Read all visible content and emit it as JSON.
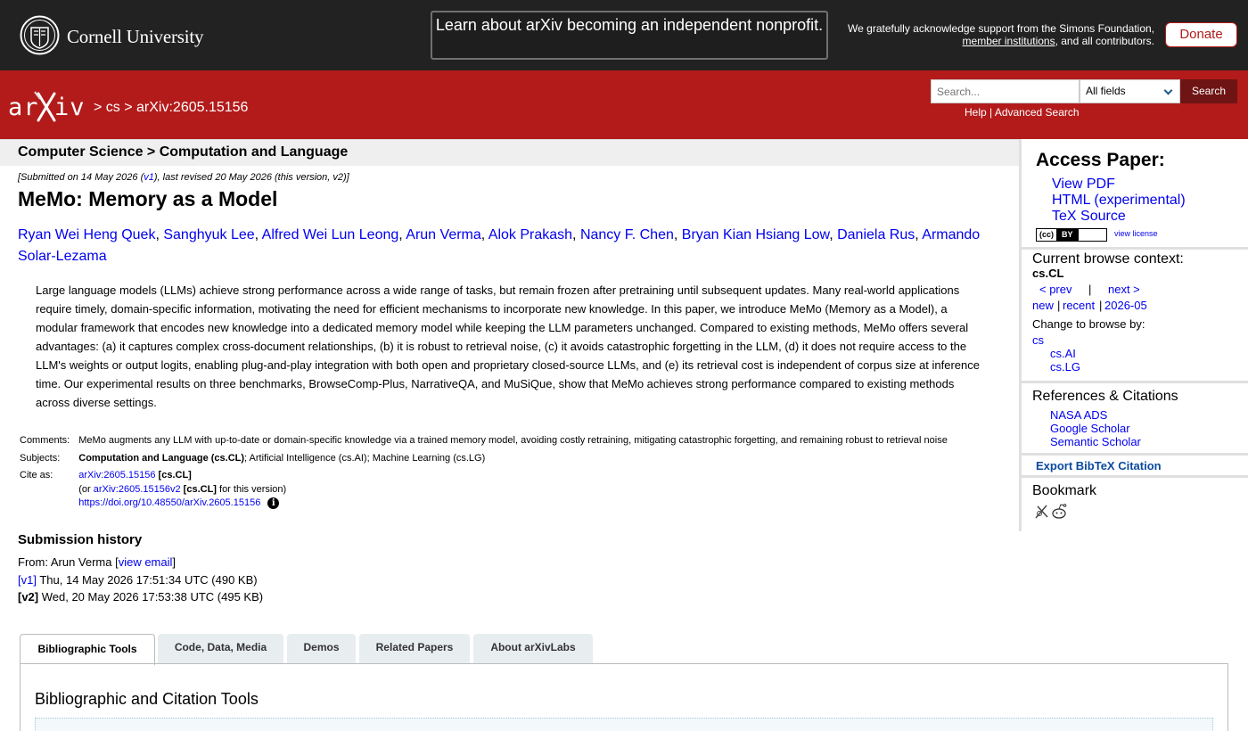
{
  "topbar": {
    "org_name": "Cornell University",
    "announcement": "Learn about arXiv becoming an independent nonprofit.",
    "support_line1": "We gratefully acknowledge support from the Simons Foundation,",
    "support_link": "member institutions",
    "support_line2_suffix": ", and all contributors.",
    "donate_label": "Donate"
  },
  "header": {
    "breadcrumb": "> cs > arXiv:2605.15156",
    "search_placeholder": "Search...",
    "field_selected": "All fields",
    "search_button": "Search",
    "help_link": "Help",
    "link_sep": " | ",
    "advanced_link": "Advanced Search"
  },
  "subheader": {
    "title": "Computer Science > Computation and Language"
  },
  "paper": {
    "dateline_prefix": "[Submitted on 14 May 2026 (",
    "dateline_v1": "v1",
    "dateline_suffix": "), last revised 20 May 2026 (this version, v2)]",
    "title": "MeMo: Memory as a Model",
    "authors": [
      "Ryan Wei Heng Quek",
      "Sanghyuk Lee",
      "Alfred Wei Lun Leong",
      "Arun Verma",
      "Alok Prakash",
      "Nancy F. Chen",
      "Bryan Kian Hsiang Low",
      "Daniela Rus",
      "Armando Solar-Lezama"
    ],
    "author_sep": ", ",
    "abstract": "Large language models (LLMs) achieve strong performance across a wide range of tasks, but remain frozen after pretraining until subsequent updates. Many real-world applications require timely, domain-specific information, motivating the need for efficient mechanisms to incorporate new knowledge. In this paper, we introduce MeMo (Memory as a Model), a modular framework that encodes new knowledge into a dedicated memory model while keeping the LLM parameters unchanged. Compared to existing methods, MeMo offers several advantages: (a) it captures complex cross-document relationships, (b) it is robust to retrieval noise, (c) it avoids catastrophic forgetting in the LLM, (d) it does not require access to the LLM's weights or output logits, enabling plug-and-play integration with both open and proprietary closed-source LLMs, and (e) its retrieval cost is independent of corpus size at inference time. Our experimental results on three benchmarks, BrowseComp-Plus, NarrativeQA, and MuSiQue, show that MeMo achieves strong performance compared to existing methods across diverse settings."
  },
  "meta": {
    "comments_label": "Comments:",
    "comments": "MeMo augments any LLM with up-to-date or domain-specific knowledge via a trained memory model, avoiding costly retraining, mitigating catastrophic forgetting, and remaining robust to retrieval noise",
    "subjects_label": "Subjects:",
    "subjects_primary": "Computation and Language (cs.CL)",
    "subjects_rest": "; Artificial Intelligence (cs.AI); Machine Learning (cs.LG)",
    "cite_label": "Cite as:",
    "cite_id": "arXiv:2605.15156",
    "cite_cat": " [cs.CL]",
    "cite_or_prefix": "(or ",
    "cite_version_id": "arXiv:2605.15156v2",
    "cite_or_suffix": " for this version)",
    "doi": "https://doi.org/10.48550/arXiv.2605.15156",
    "info_glyph": "i"
  },
  "history": {
    "title": "Submission history",
    "from_prefix": "From: Arun Verma [",
    "view_email": "view email",
    "from_suffix": "]",
    "v1_label": "[v1]",
    "v1_text": " Thu, 14 May 2026 17:51:34 UTC (490 KB)",
    "v2_label": "[v2]",
    "v2_text": " Wed, 20 May 2026 17:53:38 UTC (495 KB)"
  },
  "tabs": {
    "items": [
      "Bibliographic Tools",
      "Code, Data, Media",
      "Demos",
      "Related Papers",
      "About arXivLabs"
    ],
    "active": "Bibliographic Tools",
    "panel_title": "Bibliographic and Citation Tools"
  },
  "sidebar": {
    "access_title": "Access Paper:",
    "view_pdf": "View PDF",
    "html": "HTML (experimental)",
    "tex": "TeX Source",
    "cc_left": "(cc)",
    "cc_right": "BY",
    "view_license": "view license",
    "context_title": "Current browse context:",
    "context_value": "cs.CL",
    "prev": "< prev",
    "pipe": "|",
    "next": "next >",
    "new": "new",
    "recent": "recent",
    "month": "2026-05",
    "change_browse": "Change to browse by:",
    "browse_cs": "cs",
    "browse_ai": "cs.AI",
    "browse_lg": "cs.LG",
    "refs_title": "References & Citations",
    "nasa": "NASA ADS",
    "google": "Google Scholar",
    "semantic": "Semantic Scholar",
    "bibtex": "Export BibTeX Citation",
    "bookmark_title": "Bookmark"
  },
  "colors": {
    "arxiv_red": "#b31b1b",
    "topbar": "#222222",
    "link": "#0000ee"
  }
}
